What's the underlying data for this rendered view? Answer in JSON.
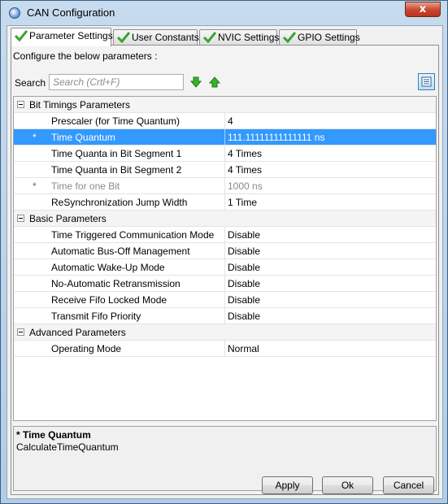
{
  "window": {
    "title": "CAN Configuration",
    "close_glyph": "x",
    "icon": "app-icon"
  },
  "tabs": [
    {
      "label": "Parameter Settings",
      "active": true,
      "icon": "check-icon"
    },
    {
      "label": "User Constants",
      "active": false,
      "icon": "check-icon"
    },
    {
      "label": "NVIC Settings",
      "active": false,
      "icon": "check-icon"
    },
    {
      "label": "GPIO Settings",
      "active": false,
      "icon": "check-icon"
    }
  ],
  "panel": {
    "configure_label": "Configure the below parameters :",
    "search_label": "Search :",
    "search_placeholder": "Search (Crtl+F)",
    "search_value": ""
  },
  "tree": {
    "groups": [
      {
        "label": "Bit Timings Parameters",
        "rows": [
          {
            "star": "",
            "name": "Prescaler (for Time Quantum)",
            "value": "4"
          },
          {
            "star": "*",
            "name": "Time Quantum",
            "value": "111.11111111111111 ns"
          },
          {
            "star": "",
            "name": "Time Quanta in Bit Segment 1",
            "value": "4 Times"
          },
          {
            "star": "",
            "name": "Time Quanta in Bit Segment 2",
            "value": "4 Times"
          },
          {
            "star": "*",
            "name": "Time for one Bit",
            "value": "1000 ns"
          },
          {
            "star": "",
            "name": "ReSynchronization Jump Width",
            "value": "1 Time"
          }
        ]
      },
      {
        "label": "Basic Parameters",
        "rows": [
          {
            "star": "",
            "name": "Time Triggered Communication Mode",
            "value": "Disable"
          },
          {
            "star": "",
            "name": "Automatic Bus-Off Management",
            "value": "Disable"
          },
          {
            "star": "",
            "name": "Automatic Wake-Up Mode",
            "value": "Disable"
          },
          {
            "star": "",
            "name": "No-Automatic Retransmission",
            "value": "Disable"
          },
          {
            "star": "",
            "name": "Receive Fifo Locked Mode",
            "value": "Disable"
          },
          {
            "star": "",
            "name": "Transmit Fifo Priority",
            "value": "Disable"
          }
        ]
      },
      {
        "label": "Advanced Parameters",
        "rows": [
          {
            "star": "",
            "name": "Operating Mode",
            "value": "Normal"
          }
        ]
      }
    ]
  },
  "description": {
    "title": "* Time Quantum",
    "body": "CalculateTimeQuantum"
  },
  "buttons": {
    "apply": "Apply",
    "ok": "Ok",
    "cancel": "Cancel"
  },
  "colors": {
    "selection": "#3399ff",
    "check": "#3aa335",
    "arrow": "#36b32c"
  }
}
